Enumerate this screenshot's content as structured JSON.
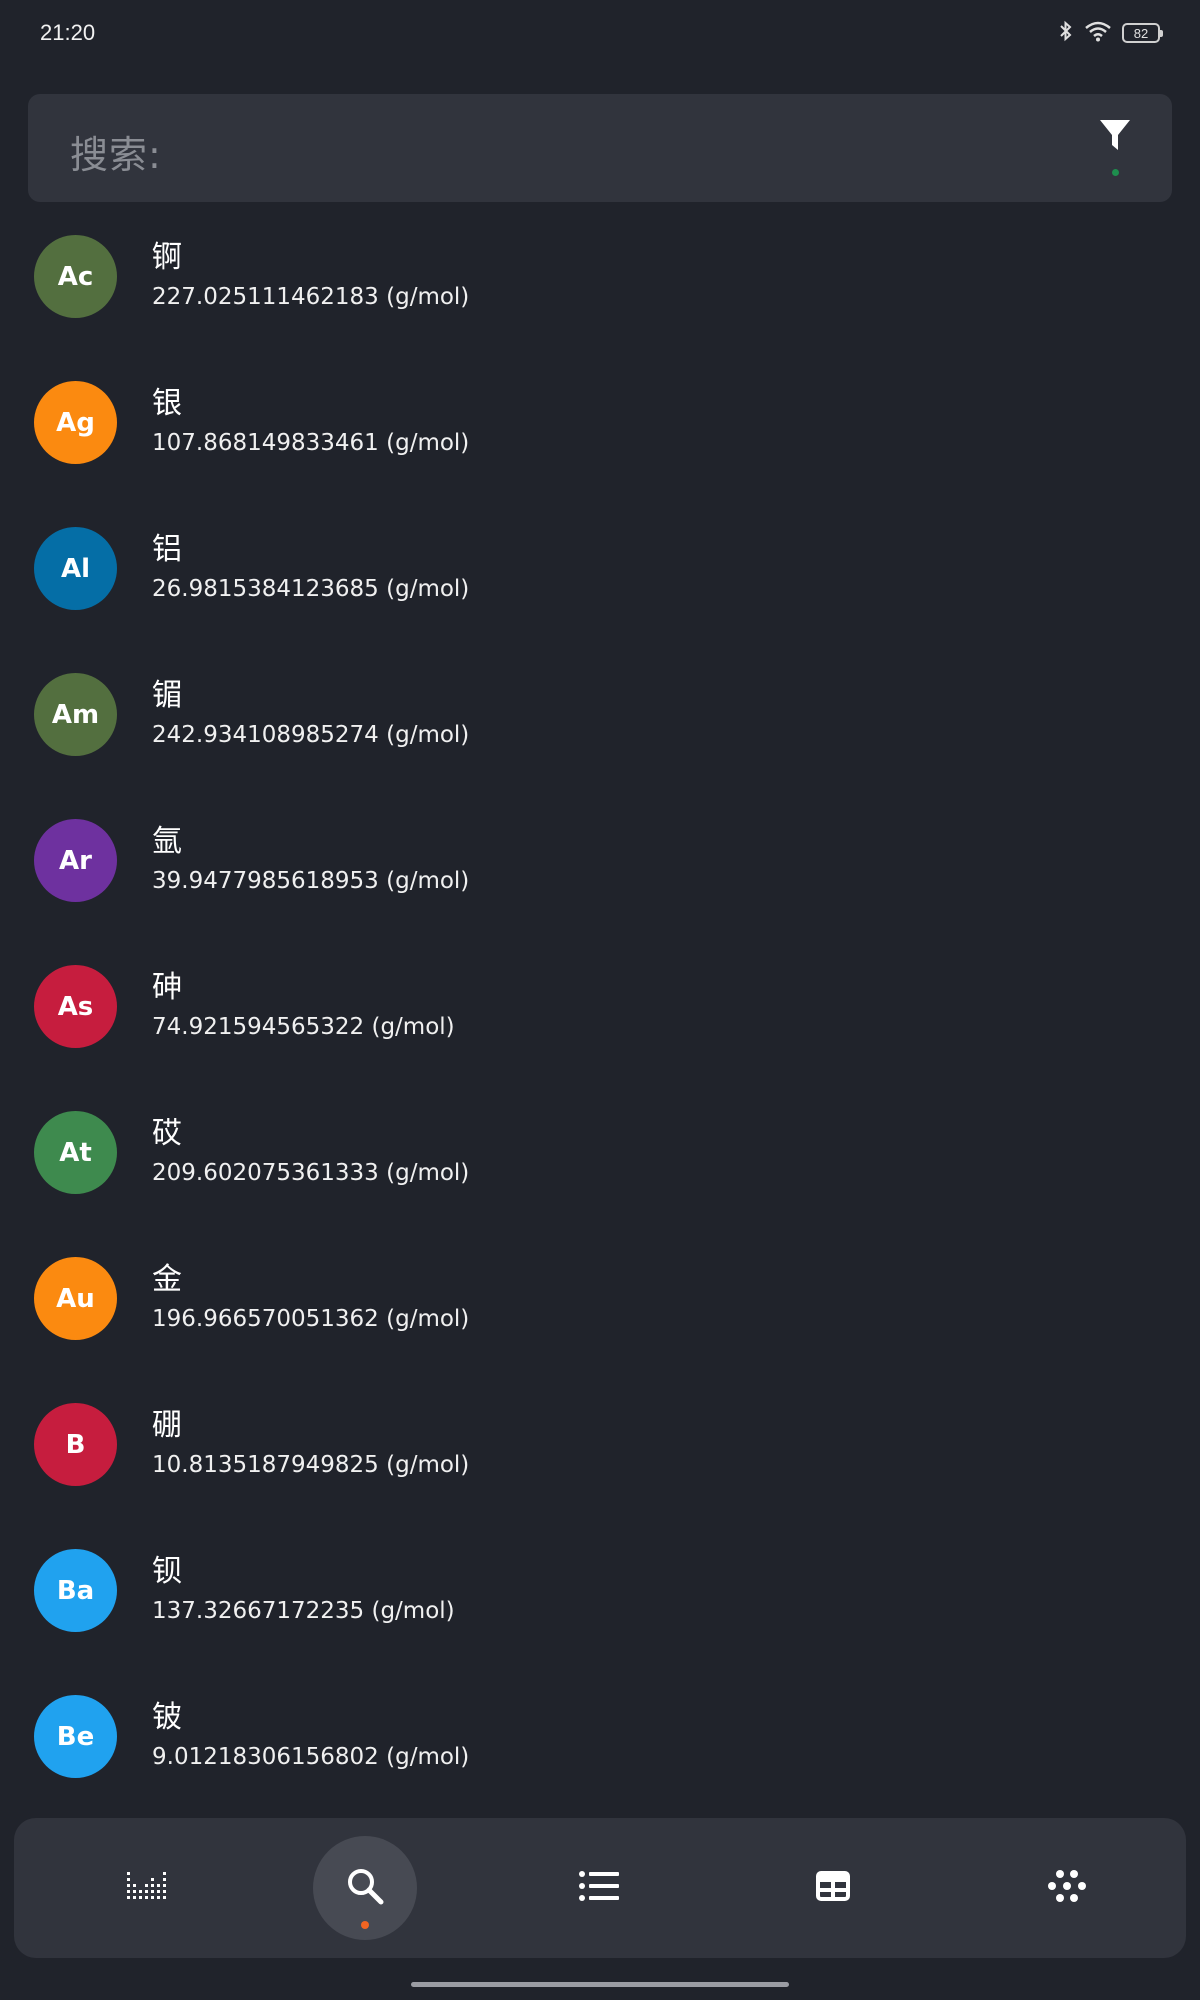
{
  "status_bar": {
    "time": "21:20",
    "battery_level": "82",
    "icons": [
      "bluetooth-icon",
      "wifi-icon",
      "battery-icon"
    ]
  },
  "search": {
    "label": "搜索:",
    "filter_icon": "filter-icon"
  },
  "elements": [
    {
      "symbol": "Ac",
      "name": "锕",
      "mass": "227.025111462183 (g/mol)",
      "color": "#536f3f"
    },
    {
      "symbol": "Ag",
      "name": "银",
      "mass": "107.868149833461 (g/mol)",
      "color": "#fb8a10"
    },
    {
      "symbol": "Al",
      "name": "铝",
      "mass": "26.9815384123685 (g/mol)",
      "color": "#056ea6"
    },
    {
      "symbol": "Am",
      "name": "镅",
      "mass": "242.934108985274 (g/mol)",
      "color": "#536f3f"
    },
    {
      "symbol": "Ar",
      "name": "氩",
      "mass": "39.9477985618953 (g/mol)",
      "color": "#6e319f"
    },
    {
      "symbol": "As",
      "name": "砷",
      "mass": "74.921594565322 (g/mol)",
      "color": "#c61d3e"
    },
    {
      "symbol": "At",
      "name": "砹",
      "mass": "209.602075361333 (g/mol)",
      "color": "#3e8a4e"
    },
    {
      "symbol": "Au",
      "name": "金",
      "mass": "196.966570051362 (g/mol)",
      "color": "#fb8a10"
    },
    {
      "symbol": "B",
      "name": "硼",
      "mass": "10.8135187949825 (g/mol)",
      "color": "#c61d3e"
    },
    {
      "symbol": "Ba",
      "name": "钡",
      "mass": "137.32667172235 (g/mol)",
      "color": "#20a2ef"
    },
    {
      "symbol": "Be",
      "name": "铍",
      "mass": "9.01218306156802 (g/mol)",
      "color": "#20a2ef"
    }
  ],
  "bottom_nav": {
    "items": [
      {
        "icon": "bar-chart-icon",
        "active": false
      },
      {
        "icon": "search-icon",
        "active": true
      },
      {
        "icon": "list-icon",
        "active": false
      },
      {
        "icon": "table-icon",
        "active": false
      },
      {
        "icon": "dots-grid-icon",
        "active": false
      }
    ],
    "active_dot_color": "#f26522"
  }
}
